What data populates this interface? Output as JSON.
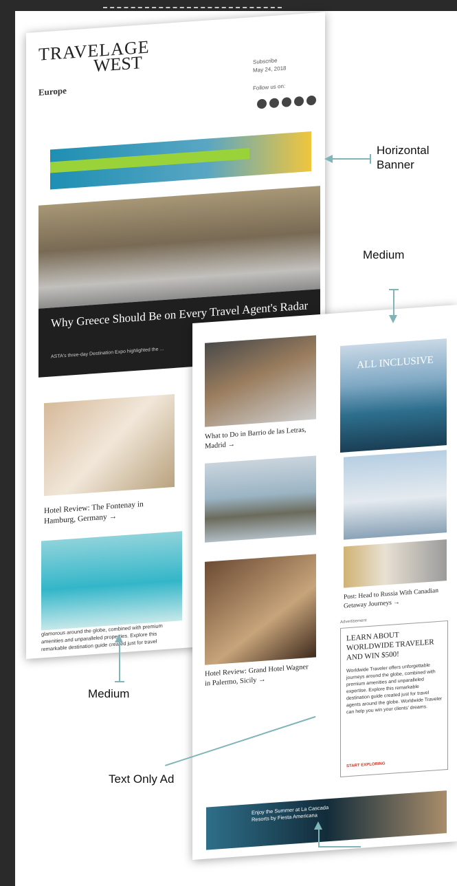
{
  "top_bar": {
    "label": ""
  },
  "newsletter_1": {
    "logo_line1": "TRAVELAGE",
    "logo_line2": "WEST",
    "region": "Europe",
    "meta_line1": "Subscribe",
    "meta_line2": "May 24, 2018",
    "follow": "Follow us on:",
    "hero_title": "Why Greece Should Be on Every Travel Agent's Radar",
    "hero_subtitle": "ASTA's three-day Destination Expo highlighted the ...",
    "hotel_caption": "Hotel Review: The Fontenay in Hamburg, Germany →",
    "pool_text": "glamorous around the globe, combined with premium amenities and unparalleled properties. Explore this remarkable destination guide created just for travel"
  },
  "newsletter_2": {
    "madrid_caption": "What to Do in Barrio de las Letras, Madrid →",
    "room_caption": "Hotel Review: Grand Hotel Wagner in Palermo, Sicily →",
    "church_caption": "Post: Head to Russia With Canadian Getaway Journeys →",
    "ad_med_title": "ALL INCLUSIVE",
    "textad_label": "Advertisement",
    "textad_title": "LEARN ABOUT WORLDWIDE TRAVELER AND WIN $500!",
    "textad_body": "Worldwide Traveler offers unforgettable journeys around the globe, combined with premium amenities and unparalleled expertise. Explore this remarkable destination guide created just for travel agents around the globe. Worldwide Traveler can help you win your clients' dreams.",
    "textad_link": "START EXPLORING",
    "banner2_text": "Enjoy the Summer at La Cascada Resorts by Fiesta Americana"
  },
  "annotations": {
    "horizontal_banner": "Horizontal Banner",
    "medium_top": "Medium",
    "medium_bottom": "Medium",
    "text_only_ad": "Text Only Ad"
  }
}
